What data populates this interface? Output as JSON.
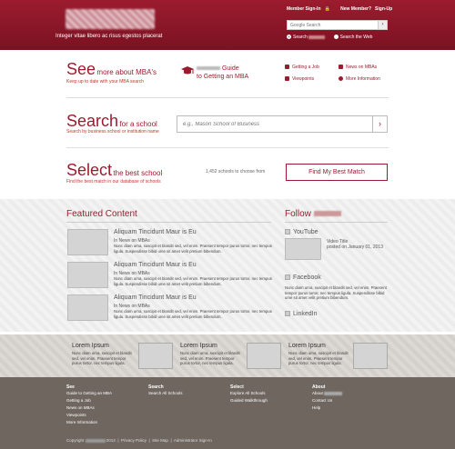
{
  "header": {
    "tagline": "Integer vitae libero ac risus egestos placerat",
    "member_signin": "Member Sign-In",
    "new_member": "New Member?",
    "signup": "Sign-Up",
    "search_placeholder": "Google Search",
    "radio_search_site": "Search",
    "radio_search_web": "Search the Web",
    "accent": "#9b1c2e"
  },
  "see": {
    "heading": "See",
    "heading_rest": "more about MBA's",
    "sub": "Keep up to date with your MBA search",
    "guide_line1": "Guide",
    "guide_line2": "to Getting an MBA",
    "links": [
      "Getting a Job",
      "Viewpoints",
      "News on MBAs",
      "More Information"
    ]
  },
  "search": {
    "heading": "Search",
    "heading_rest": "for a school",
    "sub": "Search by business school or institution name",
    "placeholder": "e.g., Mason School of Business"
  },
  "select": {
    "heading": "Select",
    "heading_rest": "the best school",
    "sub": "Find the best match in our database of schools",
    "count": "1,452 schools to choose from",
    "button": "Find My Best Match"
  },
  "featured": {
    "heading": "Featured Content",
    "items": [
      {
        "title": "Aliquam Tincidunt Maur is Eu",
        "category": "In News on MBAs",
        "body": "Nunc diam urna, suscipit et blandit sed, vel enim. Praesent tempor purus tortor, nec tempus ligula. Suspendisse bibid ume sit amet velit pretium bibendum."
      },
      {
        "title": "Aliquam Tincidunt Maur is Eu",
        "category": "In News on MBAs",
        "body": "Nunc diam urna, suscipit et blandit sed, vel enim. Praesent tempor purus tortor, nec tempus ligula. Suspendisse bibid ume sit amet velit pretium bibendum."
      },
      {
        "title": "Aliquam Tincidunt Maur is Eu",
        "category": "In News on MBAs",
        "body": "Nunc diam urna, suscipit et blandit sed, vel enim. Praesent tempor purus tortor, nec tempus ligula. Suspendisse bibid ume sit amet velit pretium bibendum."
      }
    ]
  },
  "follow": {
    "heading": "Follow",
    "youtube": "YouTube",
    "video_title": "Video Title",
    "video_date": "posted on January 01, 2013",
    "facebook": "Facebook",
    "fb_body": "Nunc diam urna, suscipit et blandit sed, vel enim. Praesent tempor purus tortor, nec tempus ligula. Suspendisse bibid ume sit amet velit pretium bibendum.",
    "linkedin": "LinkedIn"
  },
  "lorem": [
    {
      "title": "Lorem Ipsum",
      "body": "Nunc diam urna, suscipit et blandit sed, vel enim. Praesent tempor purus tortor, nec tempus ligula."
    },
    {
      "title": "Lorem Ipsum",
      "body": "Nunc diam urna, suscipit et blandit sed, vel enim. Praesent tempor purus tortor, nec tempus ligula."
    },
    {
      "title": "Lorem Ipsum",
      "body": "Nunc diam urna, suscipit et blandit sed, vel enim. Praesent tempor purus tortor, nec tempus ligula."
    }
  ],
  "footer": {
    "cols": [
      {
        "head": "See",
        "links": [
          "Guide to Getting an MBA",
          "Getting a Job",
          "News on MBAs",
          "Viewpoints",
          "More Information"
        ]
      },
      {
        "head": "Search",
        "links": [
          "Search All Schools"
        ]
      },
      {
        "head": "Select",
        "links": [
          "Explore All Schools",
          "Guided Walkthrough"
        ]
      },
      {
        "head": "About",
        "links": [
          "About",
          "Contact Us",
          "Help"
        ]
      }
    ],
    "copyright": "Copyright",
    "year": "2013",
    "privacy": "Privacy Policy",
    "sitemap": "Site Map",
    "admin": "Administrator Sign-In"
  }
}
